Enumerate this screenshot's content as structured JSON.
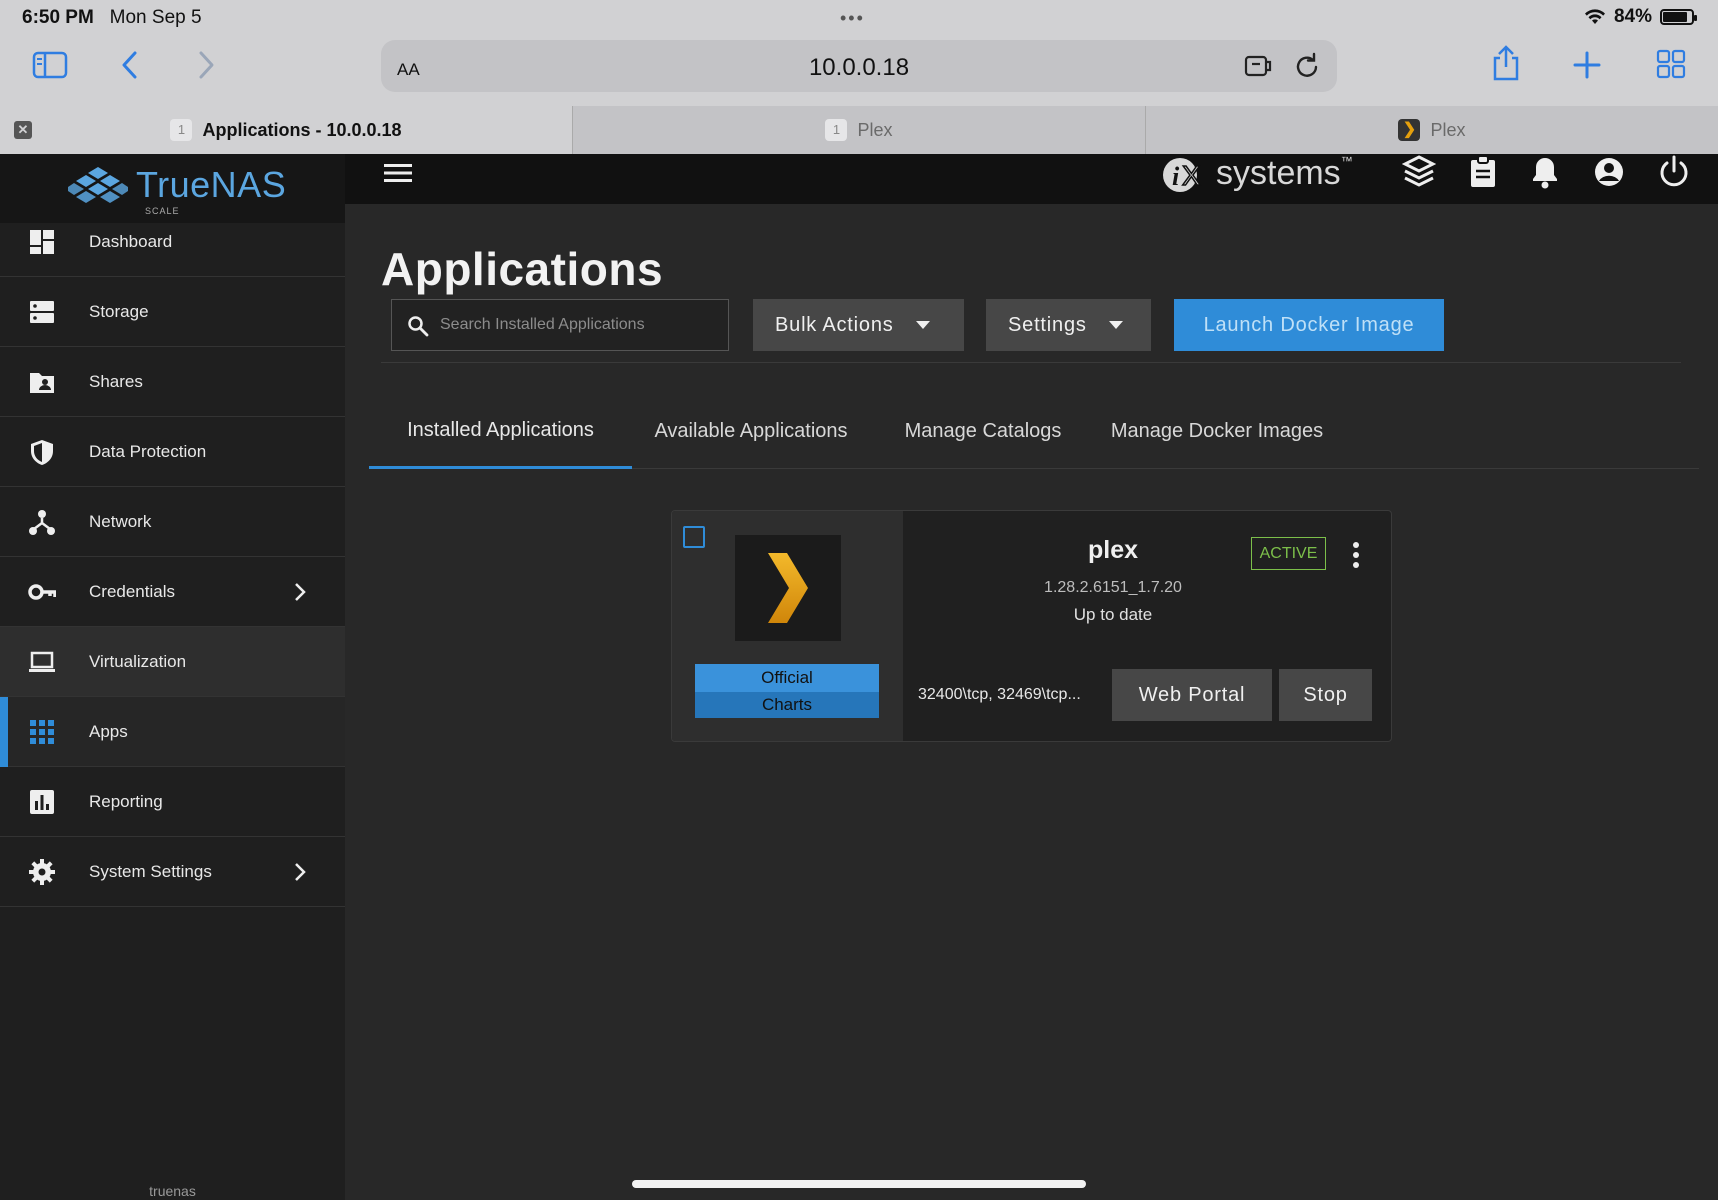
{
  "status_bar": {
    "time": "6:50 PM",
    "date": "Mon Sep 5",
    "battery": "84%",
    "battery_level": 0.84
  },
  "browser": {
    "text_size_label": "AA",
    "url": "10.0.0.18",
    "tabs": [
      {
        "title": "Applications - 10.0.0.18",
        "badge": "1",
        "active": true
      },
      {
        "title": "Plex",
        "badge": "1",
        "active": false
      },
      {
        "title": "Plex",
        "active": false
      }
    ]
  },
  "app": {
    "brand": "TrueNAS",
    "brand_sub": "SCALE",
    "vendor": "systems",
    "sidebar": {
      "items": [
        {
          "label": "Dashboard",
          "icon": "dashboard-icon"
        },
        {
          "label": "Storage",
          "icon": "storage-icon"
        },
        {
          "label": "Shares",
          "icon": "shares-folder-icon"
        },
        {
          "label": "Data Protection",
          "icon": "shield-icon"
        },
        {
          "label": "Network",
          "icon": "network-icon"
        },
        {
          "label": "Credentials",
          "icon": "key-icon",
          "expandable": true
        },
        {
          "label": "Virtualization",
          "icon": "laptop-icon"
        },
        {
          "label": "Apps",
          "icon": "apps-grid-icon",
          "active": true
        },
        {
          "label": "Reporting",
          "icon": "chart-icon"
        },
        {
          "label": "System Settings",
          "icon": "gear-icon",
          "expandable": true
        }
      ],
      "hostname": "truenas"
    },
    "page": {
      "title": "Applications",
      "search_placeholder": "Search Installed Applications",
      "bulk_actions": "Bulk Actions",
      "settings": "Settings",
      "launch_docker": "Launch Docker Image",
      "tabs": [
        {
          "label": "Installed Applications",
          "active": true
        },
        {
          "label": "Available Applications"
        },
        {
          "label": "Manage Catalogs"
        },
        {
          "label": "Manage Docker Images"
        }
      ]
    },
    "card": {
      "name": "plex",
      "version": "1.28.2.6151_1.7.20",
      "update_status": "Up to date",
      "state": "ACTIVE",
      "catalog_line1": "Official",
      "catalog_line2": "Charts",
      "ports": "32400\\tcp, 32469\\tcp...",
      "web_portal": "Web Portal",
      "stop": "Stop"
    }
  },
  "colors": {
    "accent": "#2f8cd8",
    "active_badge": "#7cbf4a",
    "plex_orange": "#e5a00d"
  }
}
